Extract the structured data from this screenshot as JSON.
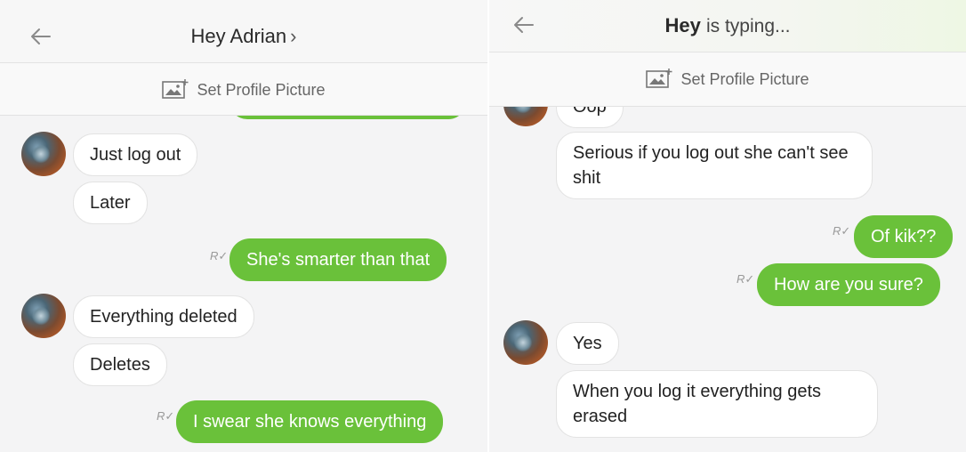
{
  "left": {
    "header": {
      "title": "Hey Adrian",
      "chevron": "›"
    },
    "profile_bar": {
      "label": "Set Profile Picture",
      "icon": "picture-add-icon"
    },
    "receipt_glyph": "R✓",
    "messages": [
      {
        "side": "in",
        "text": "Just log out"
      },
      {
        "side": "in",
        "text": "Later"
      },
      {
        "side": "out",
        "text": "She's smarter than that"
      },
      {
        "side": "in",
        "text": "Everything deleted"
      },
      {
        "side": "in",
        "text": "Deletes"
      },
      {
        "side": "out",
        "text": "I swear she knows everything"
      }
    ]
  },
  "right": {
    "header": {
      "name": "Hey",
      "status": "is typing..."
    },
    "profile_bar": {
      "label": "Set Profile Picture",
      "icon": "picture-add-icon"
    },
    "receipt_glyph": "R✓",
    "messages": [
      {
        "side": "in",
        "text": "Oop"
      },
      {
        "side": "in",
        "text": "Serious if you log out she can't see shit"
      },
      {
        "side": "out",
        "text": "Of kik??"
      },
      {
        "side": "out",
        "text": "How are you sure?"
      },
      {
        "side": "in",
        "text": "Yes"
      },
      {
        "side": "in",
        "text": "When you log it everything gets erased"
      }
    ]
  },
  "colors": {
    "outgoing_bubble": "#6ac13a",
    "incoming_bubble": "#ffffff",
    "background": "#f4f4f5",
    "accent": "#6ac13a"
  }
}
